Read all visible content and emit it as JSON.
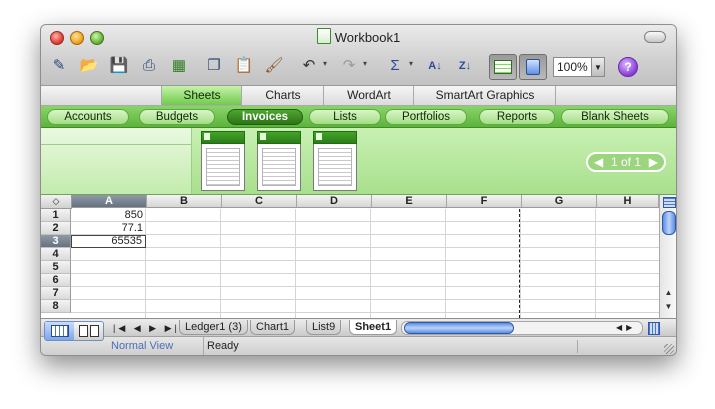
{
  "window": {
    "title": "Workbook1"
  },
  "toolbar": {
    "icons": [
      "new-icon",
      "open-icon",
      "save-icon",
      "print-icon",
      "import-icon",
      "copy-icon",
      "paste-icon",
      "format-painter-icon",
      "undo-icon",
      "redo-icon",
      "autosum-icon",
      "sort-ascending-icon",
      "sort-descending-icon",
      "gallery-icon",
      "toolbox-icon",
      "help-icon"
    ],
    "zoom": "100%",
    "help": "?"
  },
  "ribbon": {
    "tabs": [
      "Sheets",
      "Charts",
      "WordArt",
      "SmartArt Graphics"
    ],
    "active_tab": "Sheets"
  },
  "categories": {
    "items": [
      "Accounts",
      "Budgets",
      "Invoices",
      "Lists",
      "Portfolios",
      "Reports",
      "Blank Sheets"
    ],
    "active": "Invoices"
  },
  "gallery": {
    "page_indicator": "1 of 1"
  },
  "sheet": {
    "columns": [
      "A",
      "B",
      "C",
      "D",
      "E",
      "F",
      "G",
      "H"
    ],
    "rows": [
      "1",
      "2",
      "3",
      "4",
      "5",
      "6",
      "7",
      "8"
    ],
    "selected_cell": "A3",
    "cells": {
      "A1": "850",
      "A2": "77.1",
      "A3": "65535"
    }
  },
  "sheet_tabs": {
    "items": [
      "Ledger1 (3)",
      "Chart1",
      "List9",
      "Sheet1"
    ],
    "active": "Sheet1"
  },
  "status": {
    "view": "Normal View",
    "state": "Ready"
  }
}
